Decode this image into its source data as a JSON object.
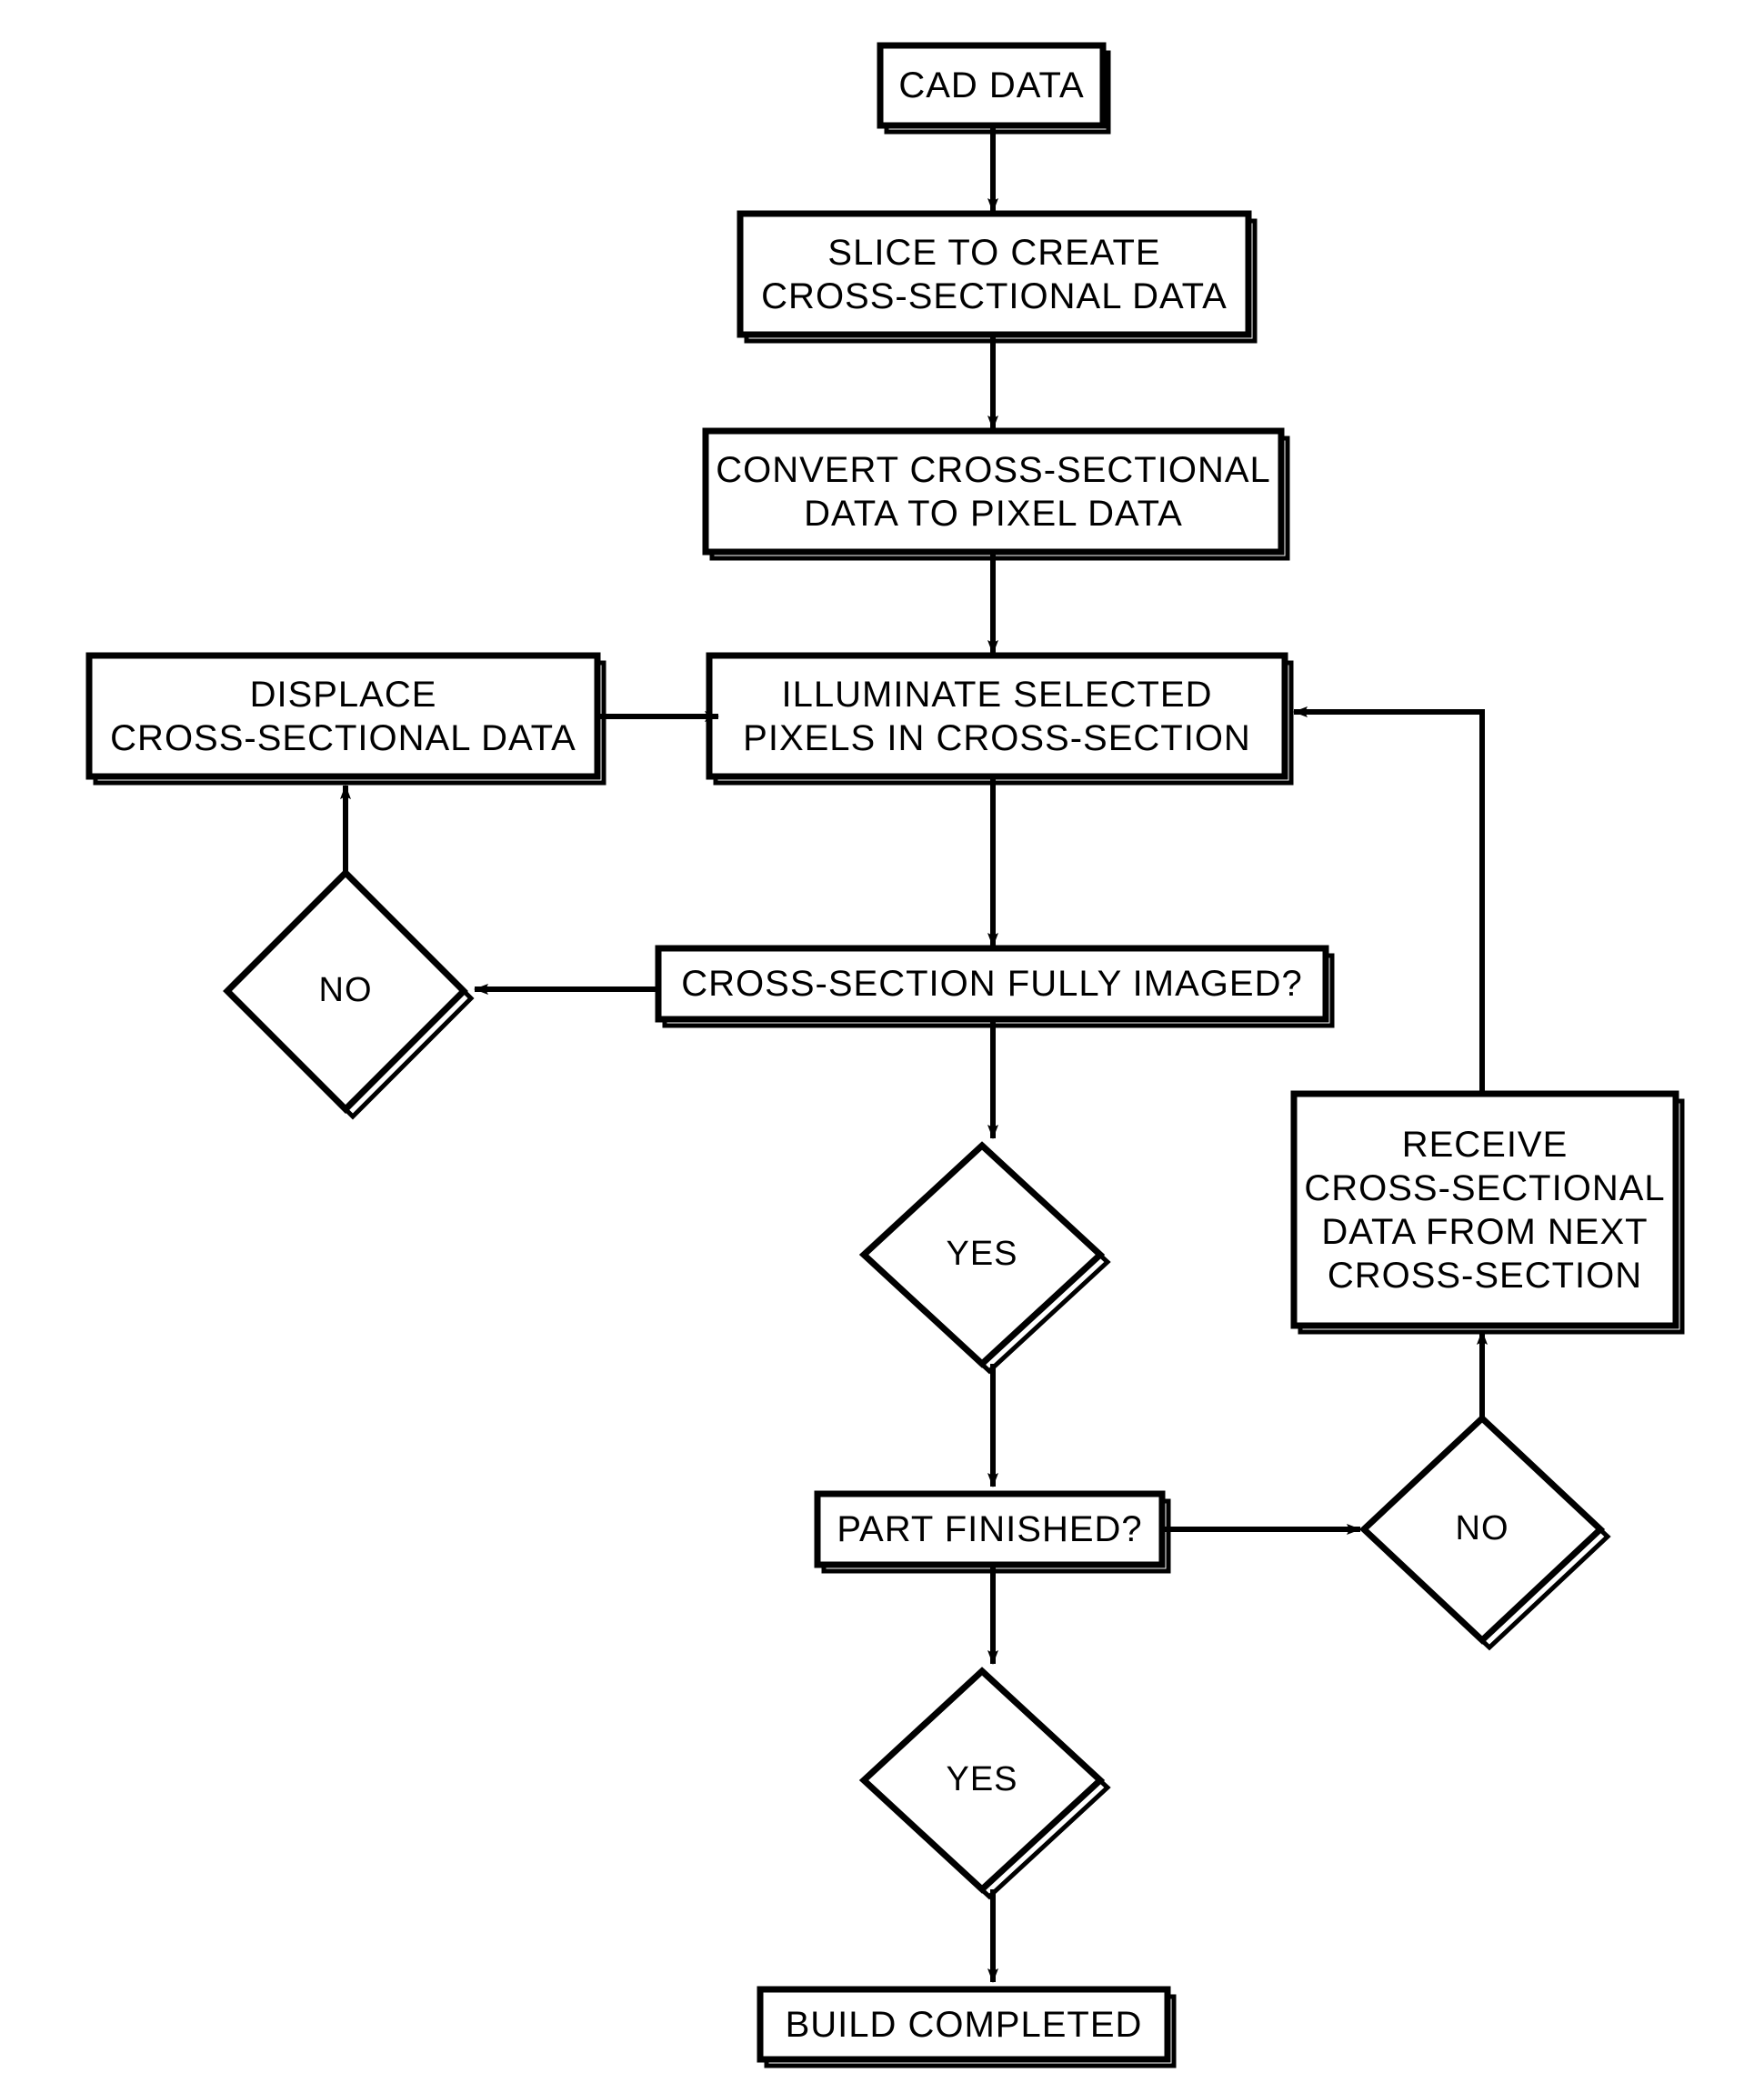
{
  "diagram": {
    "title": "Additive manufacturing build process flowchart",
    "type": "flowchart",
    "stroke_color": "#000000",
    "fill_color": "#ffffff",
    "background": "#ffffff"
  },
  "nodes": {
    "cad_data": {
      "id": "cad_data",
      "shape": "process",
      "lines": [
        "CAD DATA"
      ]
    },
    "slice": {
      "id": "slice",
      "shape": "process",
      "lines": [
        "SLICE TO CREATE",
        "CROSS-SECTIONAL DATA"
      ]
    },
    "convert": {
      "id": "convert",
      "shape": "process",
      "lines": [
        "CONVERT CROSS-SECTIONAL",
        "DATA TO PIXEL DATA"
      ]
    },
    "displace": {
      "id": "displace",
      "shape": "process",
      "lines": [
        "DISPLACE",
        "CROSS-SECTIONAL DATA"
      ]
    },
    "illuminate": {
      "id": "illuminate",
      "shape": "process",
      "lines": [
        "ILLUMINATE SELECTED",
        "PIXELS IN CROSS-SECTION"
      ]
    },
    "fully_imaged": {
      "id": "fully_imaged",
      "shape": "process",
      "lines": [
        "CROSS-SECTION FULLY IMAGED?"
      ]
    },
    "no_imaged": {
      "id": "no_imaged",
      "shape": "decision",
      "lines": [
        "NO"
      ]
    },
    "yes_imaged": {
      "id": "yes_imaged",
      "shape": "decision",
      "lines": [
        "YES"
      ]
    },
    "receive_next": {
      "id": "receive_next",
      "shape": "process",
      "lines": [
        "RECEIVE",
        "CROSS-SECTIONAL",
        "DATA FROM NEXT",
        "CROSS-SECTION"
      ]
    },
    "part_finished": {
      "id": "part_finished",
      "shape": "process",
      "lines": [
        "PART FINISHED?"
      ]
    },
    "no_finished": {
      "id": "no_finished",
      "shape": "decision",
      "lines": [
        "NO"
      ]
    },
    "yes_finished": {
      "id": "yes_finished",
      "shape": "decision",
      "lines": [
        "YES"
      ]
    },
    "build_completed": {
      "id": "build_completed",
      "shape": "process",
      "lines": [
        "BUILD COMPLETED"
      ]
    }
  },
  "edges": [
    {
      "from": "cad_data",
      "to": "slice",
      "label": ""
    },
    {
      "from": "slice",
      "to": "convert",
      "label": ""
    },
    {
      "from": "convert",
      "to": "illuminate",
      "label": ""
    },
    {
      "from": "illuminate",
      "to": "fully_imaged",
      "label": ""
    },
    {
      "from": "fully_imaged",
      "to": "no_imaged",
      "label": ""
    },
    {
      "from": "no_imaged",
      "to": "displace",
      "label": ""
    },
    {
      "from": "displace",
      "to": "illuminate",
      "label": ""
    },
    {
      "from": "fully_imaged",
      "to": "yes_imaged",
      "label": ""
    },
    {
      "from": "yes_imaged",
      "to": "part_finished",
      "label": ""
    },
    {
      "from": "part_finished",
      "to": "no_finished",
      "label": ""
    },
    {
      "from": "no_finished",
      "to": "receive_next",
      "label": ""
    },
    {
      "from": "receive_next",
      "to": "illuminate",
      "label": ""
    },
    {
      "from": "part_finished",
      "to": "yes_finished",
      "label": ""
    },
    {
      "from": "yes_finished",
      "to": "build_completed",
      "label": ""
    }
  ]
}
